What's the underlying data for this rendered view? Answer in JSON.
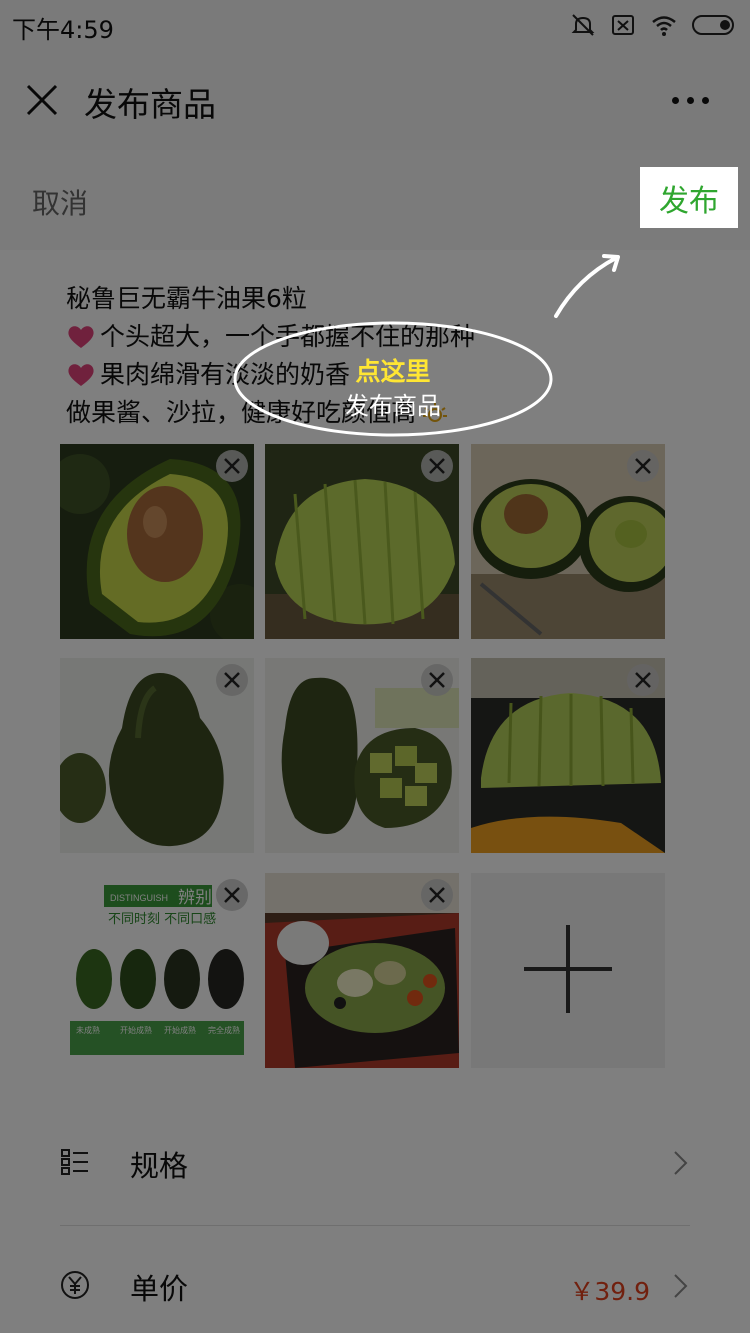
{
  "status": {
    "time": "下午4:59"
  },
  "header": {
    "title": "发布商品"
  },
  "topbar": {
    "cancel": "取消",
    "publish": "发布"
  },
  "description": {
    "title_line": "秘鲁巨无霸牛油果6粒",
    "line2": "个头超大，一个手都握不住的那种",
    "line3": "果肉绵滑有淡淡的奶香",
    "line4": "做果酱、沙拉，健康好吃颜值高"
  },
  "photos": [
    {
      "name": "avocado-half-with-pit"
    },
    {
      "name": "sliced-avocado"
    },
    {
      "name": "halved-avocados-on-table"
    },
    {
      "name": "whole-avocado"
    },
    {
      "name": "avocado-with-cubes"
    },
    {
      "name": "sliced-avocado-on-board"
    },
    {
      "name": "ripeness-guide",
      "banner": "辨别",
      "banner_en": "DISTINGUISH",
      "subtitle": "不同时刻 不同口感",
      "stages": [
        "未成熟",
        "开始成熟",
        "开始成熟",
        "完全成熟"
      ]
    },
    {
      "name": "avocado-salad"
    }
  ],
  "rows": {
    "spec": {
      "label": "规格"
    },
    "price": {
      "label": "单价",
      "value": "￥39.9"
    }
  },
  "tip": {
    "highlight": "点这里",
    "text": "发布商品"
  },
  "colors": {
    "accent_green": "#2fa62f",
    "price_red": "#e2401c",
    "tip_yellow": "#ffe633"
  }
}
